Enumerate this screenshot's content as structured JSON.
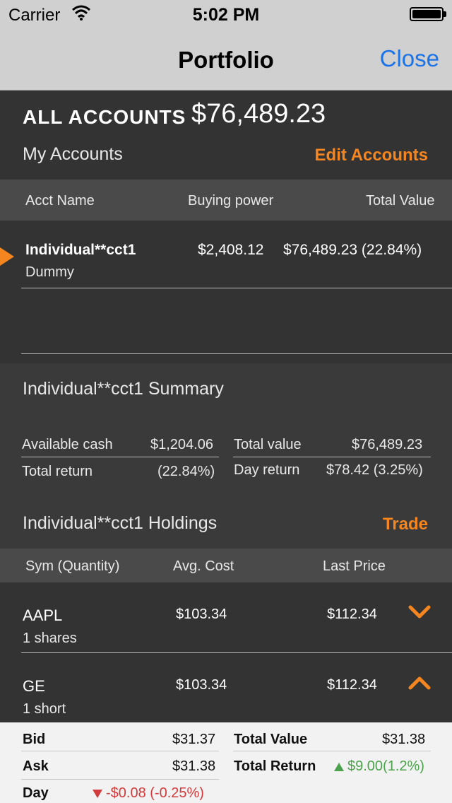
{
  "status": {
    "carrier": "Carrier",
    "time": "5:02 PM"
  },
  "nav": {
    "title": "Portfolio",
    "close": "Close"
  },
  "accounts": {
    "all_label": "ALL ACCOUNTS",
    "all_value": "$76,489.23",
    "my_accounts": "My Accounts",
    "edit": "Edit Accounts",
    "columns": [
      "Acct Name",
      "Buying power",
      "Total Value"
    ],
    "rows": [
      {
        "name": "Individual**cct1",
        "sub": "Dummy",
        "buying_power": "$2,408.12",
        "total_value": "$76,489.23 (22.84%)"
      }
    ]
  },
  "summary": {
    "title": "Individual**cct1 Summary",
    "available_cash_label": "Available cash",
    "available_cash": "$1,204.06",
    "total_value_label": "Total value",
    "total_value": "$76,489.23",
    "total_return_label": "Total return",
    "total_return": "(22.84%)",
    "day_return_label": "Day return",
    "day_return": "$78.42 (3.25%)"
  },
  "holdings": {
    "title": "Individual**cct1 Holdings",
    "trade": "Trade",
    "columns": [
      "Sym (Quantity)",
      "Avg. Cost",
      "Last Price"
    ],
    "rows": [
      {
        "sym": "AAPL",
        "qty": "1 shares",
        "avg": "$103.34",
        "last": "$112.34",
        "chevron": "chevron-down-icon"
      },
      {
        "sym": "GE",
        "qty": "1 short",
        "avg": "$103.34",
        "last": "$112.34",
        "chevron": "chevron-up-icon"
      }
    ]
  },
  "detail": {
    "bid_label": "Bid",
    "bid": "$31.37",
    "ask_label": "Ask",
    "ask": "$31.38",
    "day_label": "Day",
    "day": "-$0.08 (-0.25%)",
    "total_value_label": "Total Value",
    "total_value": "$31.38",
    "total_return_label": "Total Return",
    "total_return": "$9.00(1.2%)"
  },
  "colors": {
    "accent": "#f5861f",
    "link": "#1a73e8",
    "positive": "#4ca24c",
    "negative": "#d23b3b"
  }
}
